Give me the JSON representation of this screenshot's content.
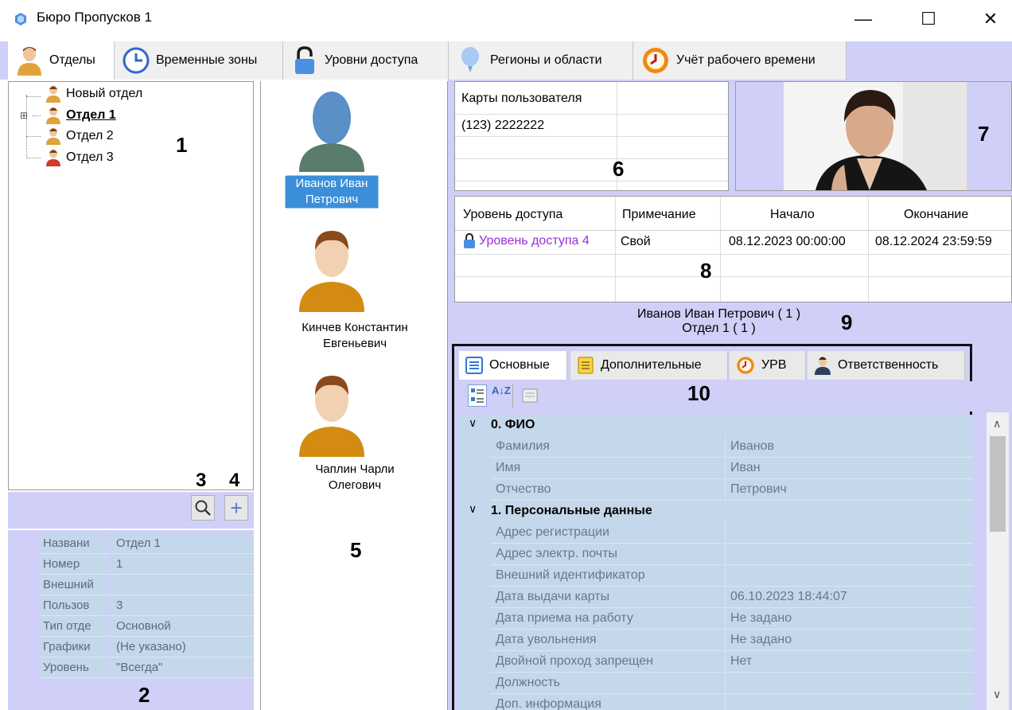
{
  "window": {
    "title": "Бюро Пропусков 1",
    "minimize": "—",
    "maximize": "☐",
    "close": "✕"
  },
  "tabs": [
    {
      "label": "Отделы",
      "icon": "person-icon"
    },
    {
      "label": "Временные зоны",
      "icon": "clock-icon"
    },
    {
      "label": "Уровни доступа",
      "icon": "lock-icon"
    },
    {
      "label": "Регионы и области",
      "icon": "balloon-icon"
    },
    {
      "label": "Учёт рабочего времени",
      "icon": "timer-icon"
    }
  ],
  "tree": {
    "items": [
      "Новый отдел",
      "Отдел 1",
      "Отдел 2",
      "Отдел 3"
    ],
    "expand_glyph": "⊞",
    "marker": "1"
  },
  "tree_toolbar": {
    "marker_search": "3",
    "marker_add": "4",
    "add_glyph": "+"
  },
  "dept_props": {
    "marker": "2",
    "rows": [
      {
        "key": "Названи",
        "value": "Отдел 1"
      },
      {
        "key": "Номер",
        "value": "1"
      },
      {
        "key": "Внешний",
        "value": ""
      },
      {
        "key": "Пользов",
        "value": "3"
      },
      {
        "key": "Тип отде",
        "value": "Основной"
      },
      {
        "key": "Графики",
        "value": "(Не указано)"
      },
      {
        "key": "Уровень",
        "value": "\"Всегда\""
      }
    ]
  },
  "people": {
    "marker": "5",
    "list": [
      {
        "line1": "Иванов Иван",
        "line2": "Петрович"
      },
      {
        "line1": "Кинчев Константин",
        "line2": "Евгеньевич"
      },
      {
        "line1": "Чаплин Чарли",
        "line2": "Олегович"
      }
    ]
  },
  "cards": {
    "header": "Карты пользователя",
    "rows": [
      "(123) 2222222"
    ],
    "marker": "6"
  },
  "photo": {
    "marker": "7"
  },
  "access": {
    "headers": [
      "Уровень доступа",
      "Примечание",
      "Начало",
      "Окончание"
    ],
    "rows": [
      {
        "level": "Уровень доступа 4",
        "note": "Свой",
        "start": "08.12.2023 00:00:00",
        "end": "08.12.2024 23:59:59"
      }
    ],
    "marker": "8"
  },
  "info": {
    "line1": "Иванов Иван Петрович ( 1 )",
    "line2": "Отдел 1 ( 1 )",
    "marker": "9"
  },
  "details": {
    "tabs": [
      {
        "label": "Основные",
        "icon": "list-icon"
      },
      {
        "label": "Дополнительные",
        "icon": "note-icon"
      },
      {
        "label": "УРВ",
        "icon": "timer-icon"
      },
      {
        "label": "Ответственность",
        "icon": "person-badge-icon"
      }
    ],
    "marker": "10",
    "sort_glyph": "A↓Z",
    "categories": [
      {
        "title": "0. ФИО",
        "rows": [
          {
            "key": "Фамилия",
            "value": "Иванов"
          },
          {
            "key": "Имя",
            "value": "Иван"
          },
          {
            "key": "Отчество",
            "value": "Петрович"
          }
        ]
      },
      {
        "title": "1. Персональные данные",
        "rows": [
          {
            "key": "Адрес регистрации",
            "value": ""
          },
          {
            "key": "Адрес электр. почты",
            "value": ""
          },
          {
            "key": "Внешний идентификатор",
            "value": ""
          },
          {
            "key": "Дата выдачи карты",
            "value": "06.10.2023 18:44:07"
          },
          {
            "key": "Дата приема на работу",
            "value": "Не задано"
          },
          {
            "key": "Дата увольнения",
            "value": "Не задано"
          },
          {
            "key": "Двойной проход запрещен",
            "value": "Нет"
          },
          {
            "key": "Должность",
            "value": ""
          },
          {
            "key": "Доп. информация",
            "value": ""
          }
        ]
      }
    ]
  },
  "colors": {
    "accent_bg": "#cfcff7",
    "grid_bg": "#c5d7ea",
    "selected": "#3b8fd9",
    "link": "#9b2fd6"
  }
}
